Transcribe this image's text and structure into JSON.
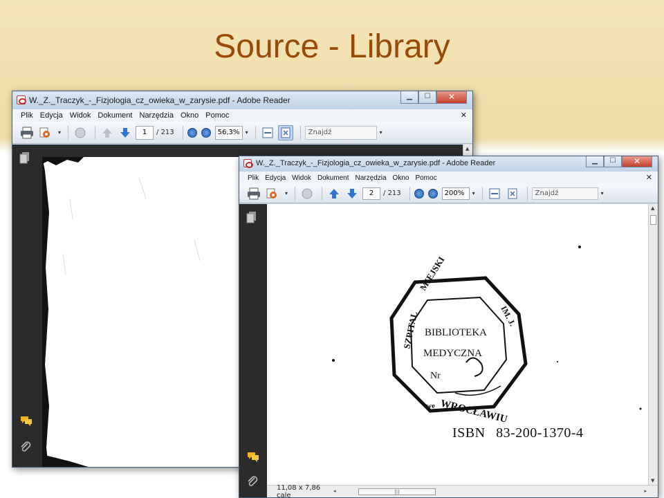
{
  "slide": {
    "title": "Source - Library"
  },
  "window_back": {
    "title": "W._Z._Traczyk_-_Fizjologia_cz_owieka_w_zarysie.pdf - Adobe Reader",
    "menu": [
      "Plik",
      "Edycja",
      "Widok",
      "Dokument",
      "Narzędzia",
      "Okno",
      "Pomoc"
    ],
    "page_current": "1",
    "page_total": "/ 213",
    "zoom": "56,3%",
    "find_placeholder": "Znajdź"
  },
  "window_front": {
    "title": "W._Z._Traczyk_-_Fizjologia_cz_owieka_w_zarysie.pdf - Adobe Reader",
    "menu": [
      "Plik",
      "Edycja",
      "Widok",
      "Dokument",
      "Narzędzia",
      "Okno",
      "Pomoc"
    ],
    "page_current": "2",
    "page_total": "/ 213",
    "zoom": "200%",
    "find_placeholder": "Znajdź",
    "status_size": "11,08 x 7,86 cale",
    "page_content": {
      "stamp": {
        "outer_text": "MIEJSKI SZPITAL Im. J. ... WE WROCŁAWIU",
        "line1": "BIBLIOTEKA",
        "line2": "MEDYCZNA",
        "number_label": "Nr"
      },
      "isbn_label": "ISBN",
      "isbn_value": "83-200-1370-4"
    }
  },
  "colors": {
    "band": "#f1e0ad",
    "title": "#9a4a06",
    "chrome": "#c9dcef",
    "pane": "#2b2b2b"
  }
}
